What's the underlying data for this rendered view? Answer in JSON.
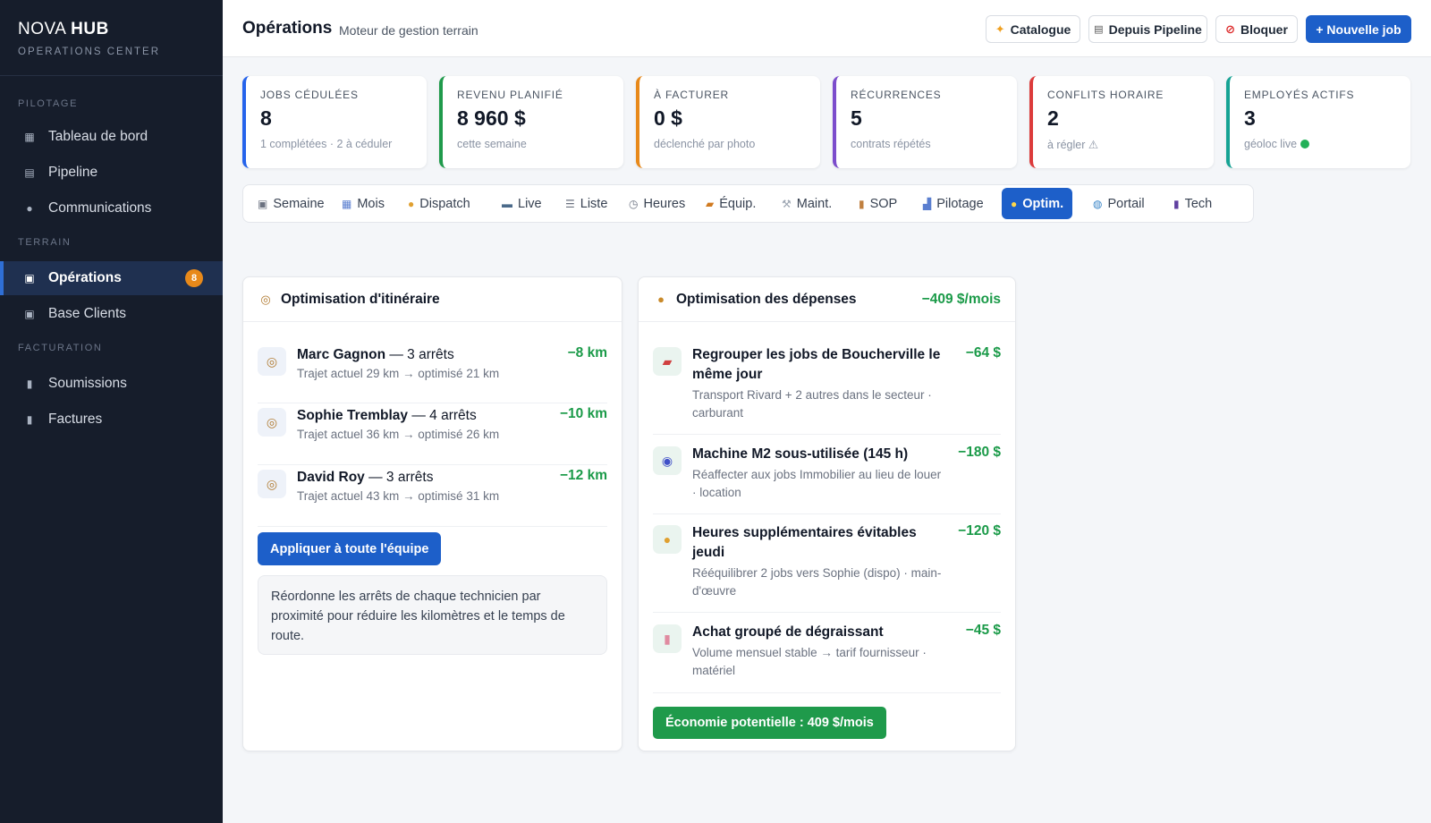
{
  "brand": {
    "name_light": "NOVA",
    "name_bold": "HUB",
    "subtitle": "OPERATIONS CENTER"
  },
  "sidebar": {
    "sections": [
      "PILOTAGE",
      "TERRAIN",
      "FACTURATION"
    ],
    "items": [
      {
        "label": "Tableau de bord",
        "icon": "grid-icon"
      },
      {
        "label": "Pipeline",
        "icon": "list-icon"
      },
      {
        "label": "Communications",
        "icon": "chat-bubble-icon"
      },
      {
        "label": "Opérations",
        "icon": "calendar-icon",
        "badge": "8",
        "active": true
      },
      {
        "label": "Base Clients",
        "icon": "square-icon"
      },
      {
        "label": "Soumissions",
        "icon": "document-icon"
      },
      {
        "label": "Factures",
        "icon": "invoice-icon"
      }
    ]
  },
  "header": {
    "title": "Opérations",
    "subtitle": "Moteur de gestion terrain",
    "buttons": {
      "catalogue": "Catalogue",
      "pipeline": "Depuis Pipeline",
      "block": "Bloquer",
      "new_job": "+ Nouvelle job"
    }
  },
  "kpis": [
    {
      "label": "JOBS CÉDULÉES",
      "value": "8",
      "sub": "1 complétées · 2 à céduler",
      "color": "#2563eb"
    },
    {
      "label": "REVENU PLANIFIÉ",
      "value": "8 960 $",
      "sub": "cette semaine",
      "color": "#1f9a4b"
    },
    {
      "label": "À FACTURER",
      "value": "0 $",
      "sub": "déclenché par photo",
      "color": "#e8891a"
    },
    {
      "label": "RÉCURRENCES",
      "value": "5",
      "sub": "contrats répétés",
      "color": "#7c4dcc"
    },
    {
      "label": "CONFLITS HORAIRE",
      "value": "2",
      "sub": "à régler ⚠",
      "color": "#dc3b3b"
    },
    {
      "label": "EMPLOYÉS ACTIFS",
      "value": "3",
      "sub": "géoloc live",
      "color": "#16a394"
    }
  ],
  "tabs": [
    {
      "label": "Semaine",
      "icon": "calendar-week-icon"
    },
    {
      "label": "Mois",
      "icon": "calendar-month-icon"
    },
    {
      "label": "Dispatch",
      "icon": "worker-icon"
    },
    {
      "label": "Live",
      "icon": "map-icon"
    },
    {
      "label": "Liste",
      "icon": "list-icon"
    },
    {
      "label": "Heures",
      "icon": "clock-icon"
    },
    {
      "label": "Équip.",
      "icon": "truck-icon"
    },
    {
      "label": "Maint.",
      "icon": "wrench-icon"
    },
    {
      "label": "SOP",
      "icon": "clipboard-icon"
    },
    {
      "label": "Pilotage",
      "icon": "chart-icon"
    },
    {
      "label": "Optim.",
      "icon": "lightbulb-icon",
      "active": true
    },
    {
      "label": "Portail",
      "icon": "globe-icon"
    },
    {
      "label": "Tech",
      "icon": "phone-icon"
    }
  ],
  "route_panel": {
    "title": "Optimisation d'itinéraire",
    "rows": [
      {
        "name": "Marc Gagnon",
        "stops": "— 3 arrêts",
        "desc": "Trajet actuel 29 km → optimisé 21 km",
        "value": "−8 km"
      },
      {
        "name": "Sophie Tremblay",
        "stops": "— 4 arrêts",
        "desc": "Trajet actuel 36 km → optimisé 26 km",
        "value": "−10 km"
      },
      {
        "name": "David Roy",
        "stops": "— 3 arrêts",
        "desc": "Trajet actuel 43 km → optimisé 31 km",
        "value": "−12 km"
      }
    ],
    "apply_label": "Appliquer à toute l'équipe",
    "note": "Réordonne les arrêts de chaque technicien par proximité pour réduire les kilomètres et le temps de route."
  },
  "expense_panel": {
    "title": "Optimisation des dépenses",
    "total": "−409 $/mois",
    "rows": [
      {
        "icon": "car-icon",
        "title": "Regrouper les jobs de Boucherville le même jour",
        "desc": "Transport Rivard + 2 autres dans le secteur · carburant",
        "value": "−64 $"
      },
      {
        "icon": "cyclone-icon",
        "title": "Machine M2 sous-utilisée (145 h)",
        "desc": "Réaffecter aux jobs Immobilier au lieu de louer · location",
        "value": "−180 $"
      },
      {
        "icon": "worker-icon",
        "title": "Heures supplémentaires évitables jeudi",
        "desc": "Rééquilibrer 2 jobs vers Sophie (dispo) · main-d'œuvre",
        "value": "−120 $"
      },
      {
        "icon": "bottle-icon",
        "title": "Achat groupé de dégraissant",
        "desc": "Volume mensuel stable → tarif fournisseur · matériel",
        "value": "−45 $"
      }
    ],
    "savings_label": "Économie potentielle : 409 $/mois"
  }
}
